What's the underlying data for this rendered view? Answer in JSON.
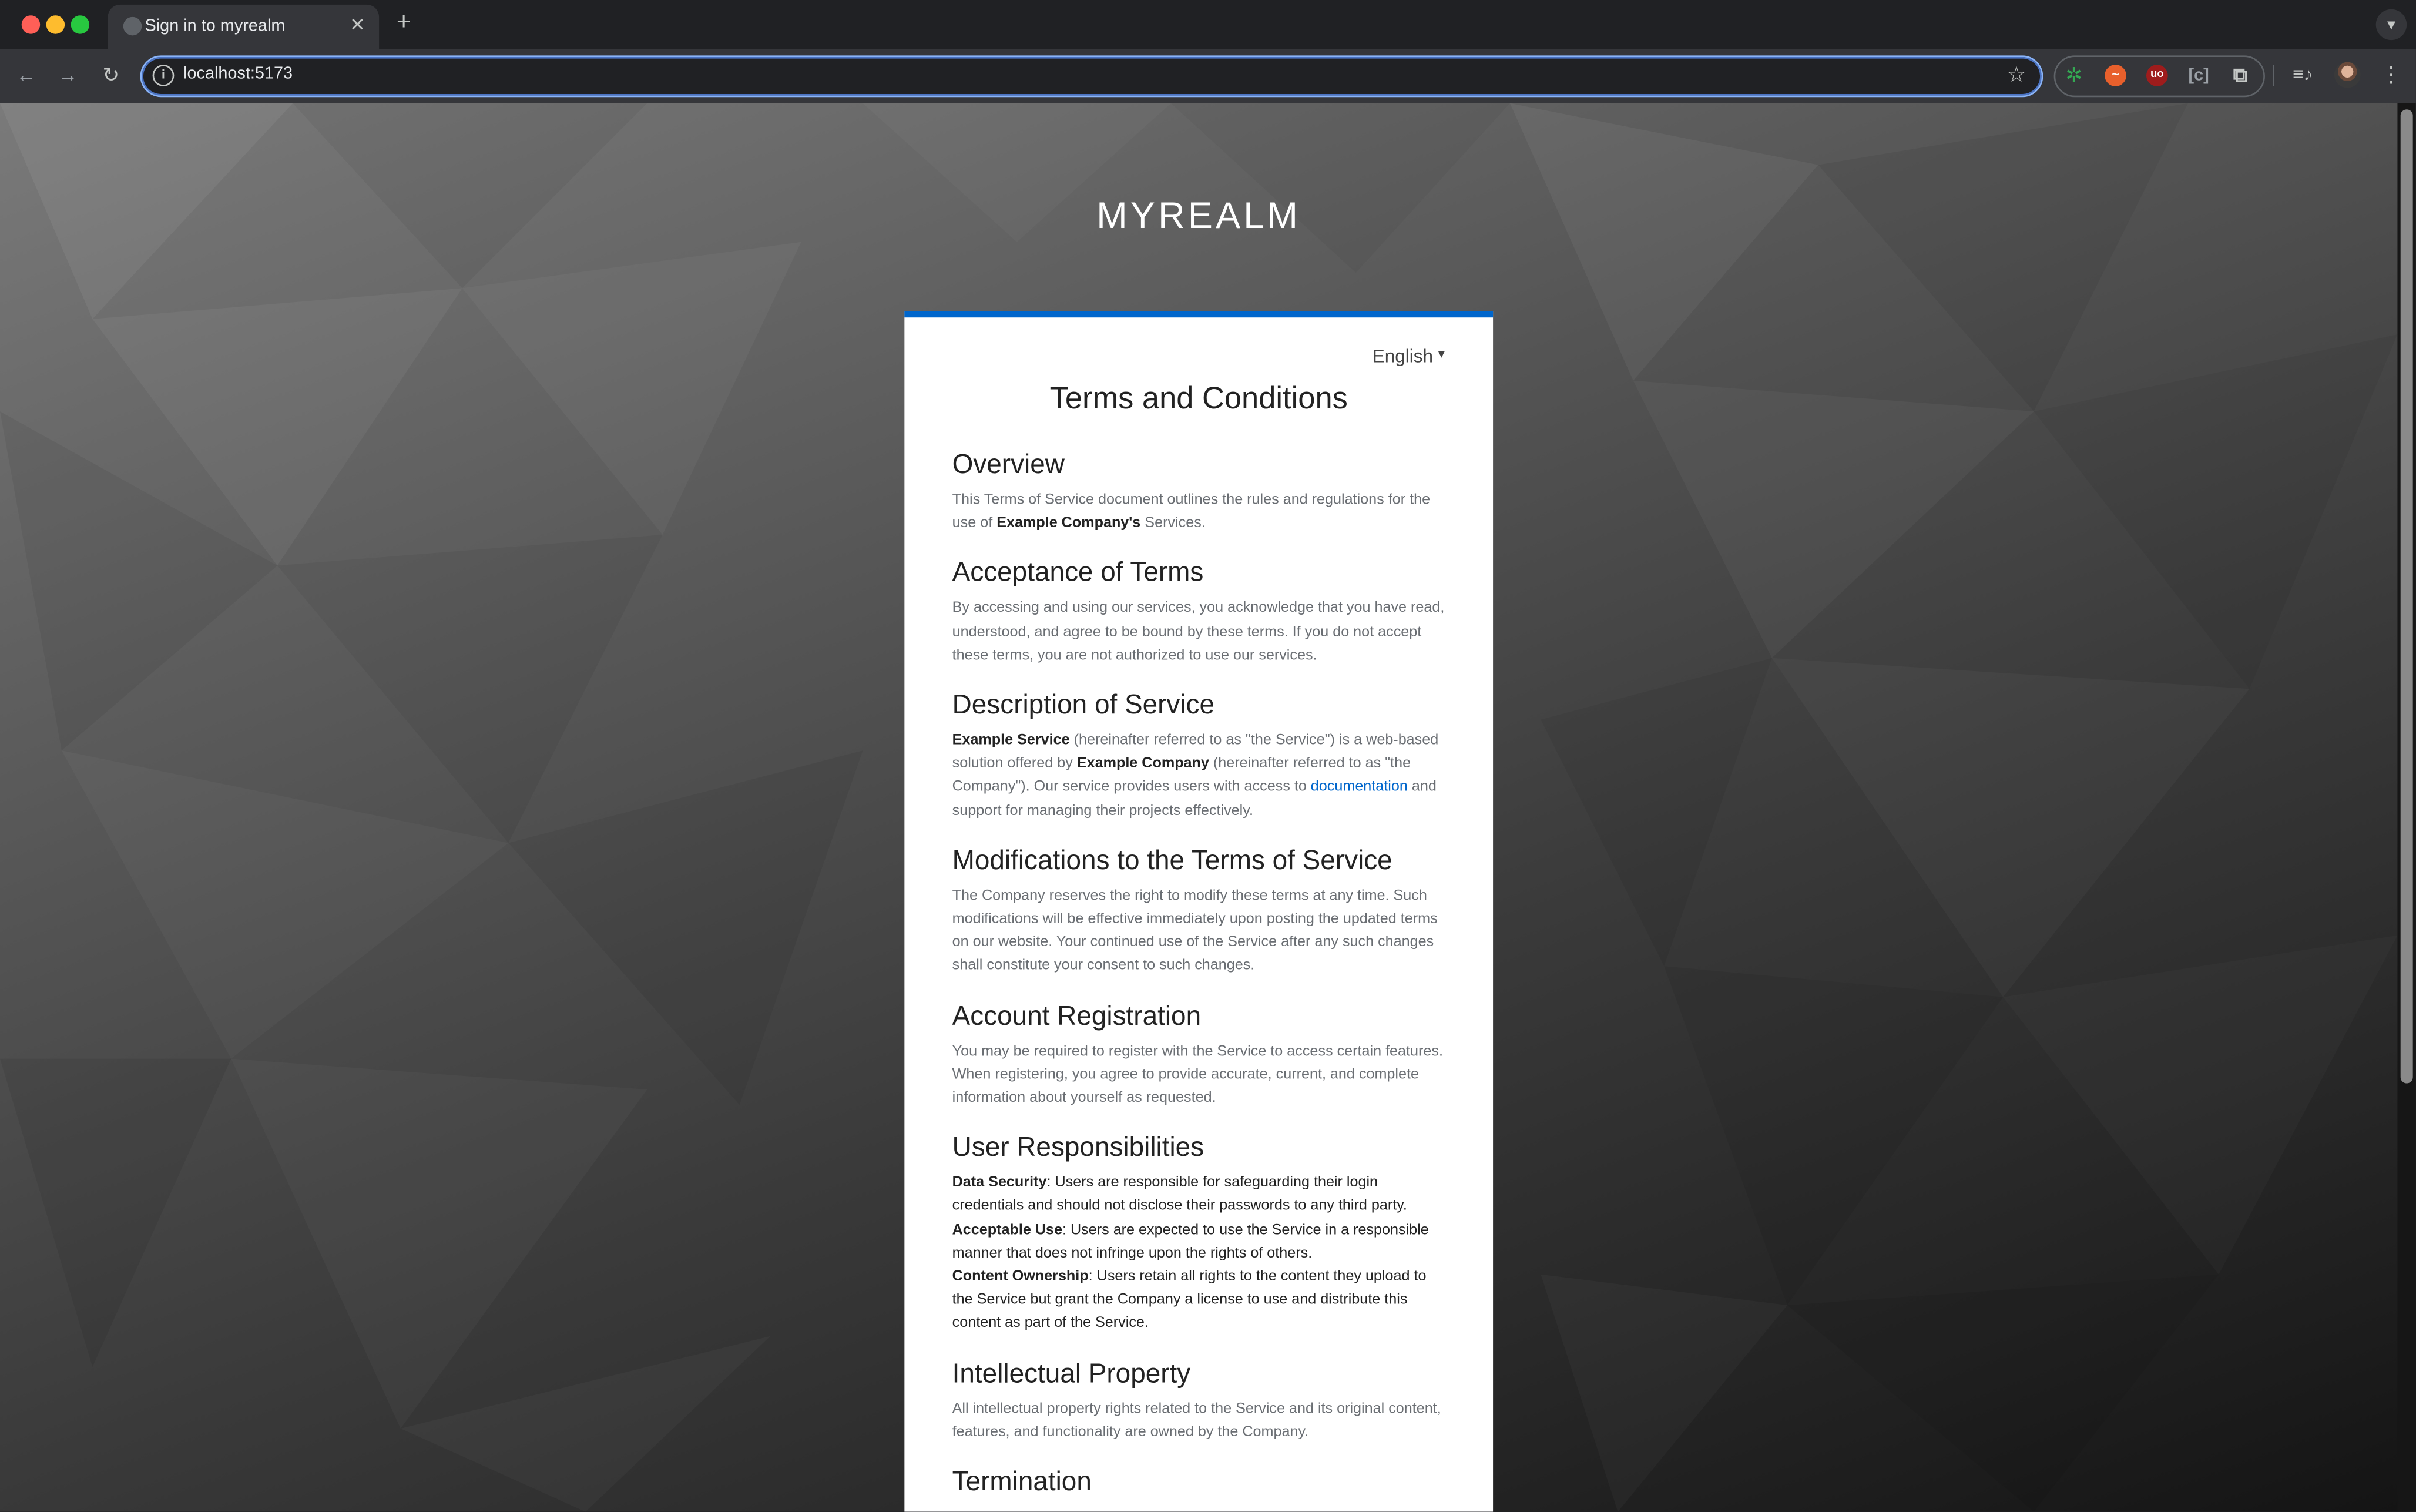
{
  "browser": {
    "tab_title": "Sign in to myrealm",
    "url": "localhost:5173",
    "icons": [
      "close-icon",
      "plus-icon",
      "back-icon",
      "forward-icon",
      "reload-icon",
      "info-icon",
      "star-icon",
      "extensions-icon",
      "media-icon",
      "menu-icon"
    ]
  },
  "page": {
    "realm_title": "MYREALM",
    "language": "English",
    "title": "Terms and Conditions",
    "accent_color": "#0066cc",
    "sections": {
      "overview": {
        "heading": "Overview",
        "t1": "This Terms of Service document outlines the rules and regulations for the use of ",
        "b1": "Example Company's",
        "t2": " Services."
      },
      "acceptance": {
        "heading": "Acceptance of Terms",
        "text": "By accessing and using our services, you acknowledge that you have read, understood, and agree to be bound by these terms. If you do not accept these terms, you are not authorized to use our services."
      },
      "description": {
        "heading": "Description of Service",
        "b1": "Example Service",
        "t1": " (hereinafter referred to as \"the Service\") is a web-based solution offered by ",
        "b2": "Example Company",
        "t2": " (hereinafter referred to as \"the Company\"). Our service provides users with access to ",
        "link": "documentation",
        "t3": " and support for managing their projects effectively."
      },
      "modifications": {
        "heading": "Modifications to the Terms of Service",
        "text": "The Company reserves the right to modify these terms at any time. Such modifications will be effective immediately upon posting the updated terms on our website. Your continued use of the Service after any such changes shall constitute your consent to such changes."
      },
      "registration": {
        "heading": "Account Registration",
        "text": "You may be required to register with the Service to access certain features. When registering, you agree to provide accurate, current, and complete information about yourself as requested."
      },
      "responsibilities": {
        "heading": "User Responsibilities",
        "b1": "Data Security",
        "t1": ": Users are responsible for safeguarding their login credentials and should not disclose their passwords to any third party.",
        "b2": "Acceptable Use",
        "t2": ": Users are expected to use the Service in a responsible manner that does not infringe upon the rights of others.",
        "b3": "Content Ownership",
        "t3": ": Users retain all rights to the content they upload to the Service but grant the Company a license to use and distribute this content as part of the Service."
      },
      "ip": {
        "heading": "Intellectual Property",
        "text": "All intellectual property rights related to the Service and its original content, features, and functionality are owned by the Company."
      },
      "termination": {
        "heading": "Termination"
      }
    }
  }
}
